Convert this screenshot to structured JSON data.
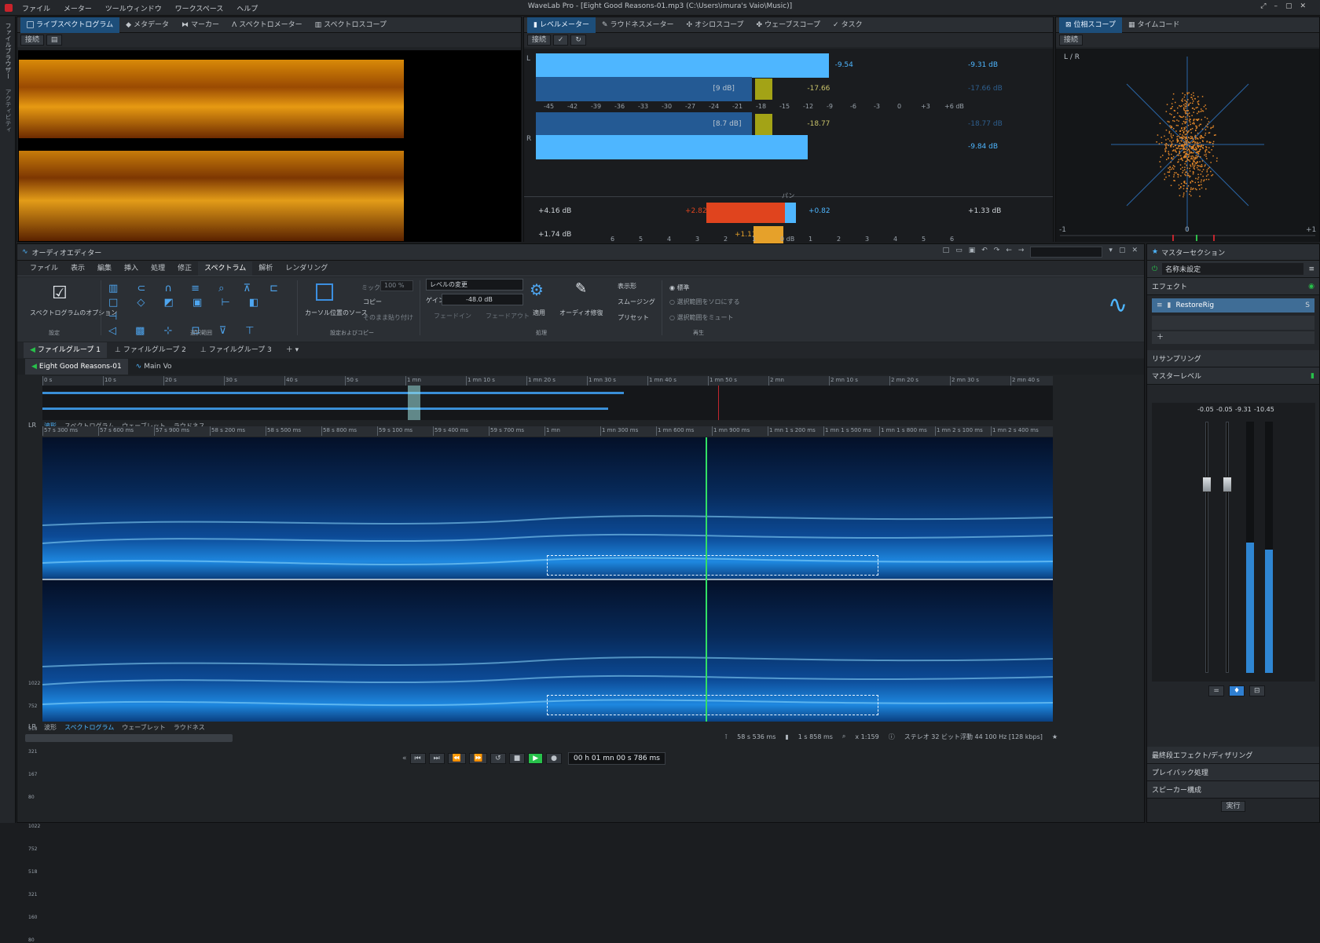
{
  "window": {
    "title": "WaveLab Pro - [Eight Good Reasons-01.mp3 (C:\\Users\\imura's Vaio\\Music)]",
    "menus": [
      "ファイル",
      "メーター",
      "ツールウィンドウ",
      "ワークスペース",
      "ヘルプ"
    ]
  },
  "left_strip": {
    "labels": [
      "ファイルブラウザー",
      "アクティビティ"
    ]
  },
  "spectro_panel": {
    "tabs": [
      "ライブスペクトログラム",
      "メタデータ",
      "マーカー",
      "スペクトロメーター",
      "スペクトロスコープ"
    ],
    "toolbar": {
      "button": "接続"
    }
  },
  "level_panel": {
    "tabs": [
      "レベルメーター",
      "ラウドネスメーター",
      "オシロスコープ",
      "ウェーブスコープ",
      "タスク"
    ],
    "toolbar": {
      "button": "接続"
    },
    "channels": {
      "left": "L",
      "right": "R"
    },
    "rows": [
      {
        "inner": "",
        "marker": "-9.54",
        "right": "-9.31 dB",
        "level_pct": 0.69,
        "peak_pct": 0.0
      },
      {
        "inner": "[9 dB]",
        "marker": "-17.66",
        "right": "-17.66 dB",
        "level_pct": 0.51,
        "peak_pct": 0.48
      },
      {
        "inner": "[8.7 dB]",
        "marker": "-18.77",
        "right": "-18.77 dB",
        "level_pct": 0.51,
        "peak_pct": 0.48
      },
      {
        "inner": "",
        "marker": "",
        "right": "-9.84 dB",
        "level_pct": 0.64,
        "peak_pct": 0.0
      }
    ],
    "scale": [
      "-45",
      "-42",
      "-39",
      "-36",
      "-33",
      "-30",
      "-27",
      "-24",
      "-21",
      "-18",
      "-15",
      "-12",
      "-9",
      "-6",
      "-3",
      "0",
      "+3",
      "+6 dB"
    ],
    "pan_label": "パン",
    "pan_rows": [
      {
        "left": "+4.16 dB",
        "value": "+2.82",
        "value2": "+0.82",
        "right": "+1.33 dB"
      },
      {
        "left": "+1.74 dB",
        "value": "+1.11",
        "value2": "",
        "right": ""
      }
    ],
    "pan_scale": [
      "6",
      "5",
      "4",
      "3",
      "2",
      "1",
      "0 dB",
      "1",
      "2",
      "3",
      "4",
      "5",
      "6"
    ]
  },
  "phase_panel": {
    "tabs": [
      "位相スコープ",
      "タイムコード"
    ],
    "toolbar": {
      "button": "接続"
    },
    "corner_label": "L / R",
    "axis": [
      "-1",
      "0",
      "+1"
    ]
  },
  "audio_editor": {
    "title": "オーディオエディター",
    "ribbon_tabs": [
      "ファイル",
      "表示",
      "編集",
      "挿入",
      "処理",
      "修正",
      "スペクトラム",
      "解析",
      "レンダリング"
    ],
    "active_tab_index": 6,
    "spectrum_option_label": "スペクトログラムのオプション",
    "group_labels": [
      "設定",
      "選択範囲",
      "設定およびコピー",
      "処理",
      "再生"
    ],
    "cursor_source_label": "カーソル位置のソース",
    "mix_label": "ミックス",
    "mix_value": "100 %",
    "copy_label": "コピー",
    "paste_label": "そのまま貼り付け",
    "process_select": "レベルの変更",
    "gain_label": "ゲイン",
    "gain_value": "-48.0 dB",
    "fade_in": "フェードイン",
    "fade_out": "フェードアウト",
    "apply_label": "適用",
    "repair_label": "オーディオ修復",
    "display_items": [
      "表示形",
      "スムージング",
      "プリセット"
    ],
    "play_options": [
      "標準",
      "選択範囲をソロにする",
      "選択範囲をミュート"
    ],
    "file_groups": [
      "ファイルグループ 1",
      "ファイルグループ 2",
      "ファイルグループ 3"
    ],
    "file_tabs": [
      "Eight Good Reasons-01",
      "Main Vo"
    ],
    "overview_ruler": [
      "0 s",
      "10 s",
      "20 s",
      "30 s",
      "40 s",
      "50 s",
      "1 mn",
      "1 mn 10 s",
      "1 mn 20 s",
      "1 mn 30 s",
      "1 mn 40 s",
      "1 mn 50 s",
      "2 mn",
      "2 mn 10 s",
      "2 mn 20 s",
      "2 mn 30 s",
      "2 mn 40 s"
    ],
    "view_tabs": [
      "LR",
      "波形",
      "スペクトログラム",
      "ウェーブレット",
      "ラウドネス"
    ],
    "main_ruler": [
      "57 s 300 ms",
      "57 s 600 ms",
      "57 s 900 ms",
      "58 s 200 ms",
      "58 s 500 ms",
      "58 s 800 ms",
      "59 s 100 ms",
      "59 s 400 ms",
      "59 s 700 ms",
      "1 mn",
      "1 mn 300 ms",
      "1 mn 600 ms",
      "1 mn 900 ms",
      "1 mn 1 s 200 ms",
      "1 mn 1 s 500 ms",
      "1 mn 1 s 800 ms",
      "1 mn 2 s 100 ms",
      "1 mn 2 s 400 ms"
    ],
    "freq_top": [
      "1022",
      "752",
      "518",
      "321",
      "167",
      "80"
    ],
    "freq_bottom": [
      "1022",
      "752",
      "518",
      "321",
      "160",
      "80"
    ],
    "status": {
      "cursor": "58 s 536 ms",
      "selection": "1 s 858 ms",
      "zoom": "x 1:159",
      "format": "ステレオ 32 ビット浮動 44 100 Hz [128 kbps]"
    },
    "timecode": "00 h 01 mn 00 s 786 ms"
  },
  "master": {
    "title": "マスターセクション",
    "preset": "名称未設定",
    "effects_label": "エフェクト",
    "plugin": "RestoreRig",
    "resample_label": "リサンプリング",
    "master_level_label": "マスターレベル",
    "readouts": [
      "-0.05",
      "-0.05",
      "-9.31",
      "-10.45"
    ],
    "fader_pct": [
      0.22,
      0.22
    ],
    "meter_pct": [
      0.52,
      0.49
    ],
    "footer_items": [
      "最終段エフェクト/ディザリング",
      "プレイバック処理",
      "スピーカー構成"
    ],
    "render_label": "実行"
  },
  "colors": {
    "accent": "#2f7fd1",
    "meter": "#4eb6ff",
    "meter_dark": "#245a94",
    "peak": "#a3a316",
    "pan_red": "#e0441e",
    "pan_orange": "#e6a12a",
    "play_green": "#27c14a"
  }
}
